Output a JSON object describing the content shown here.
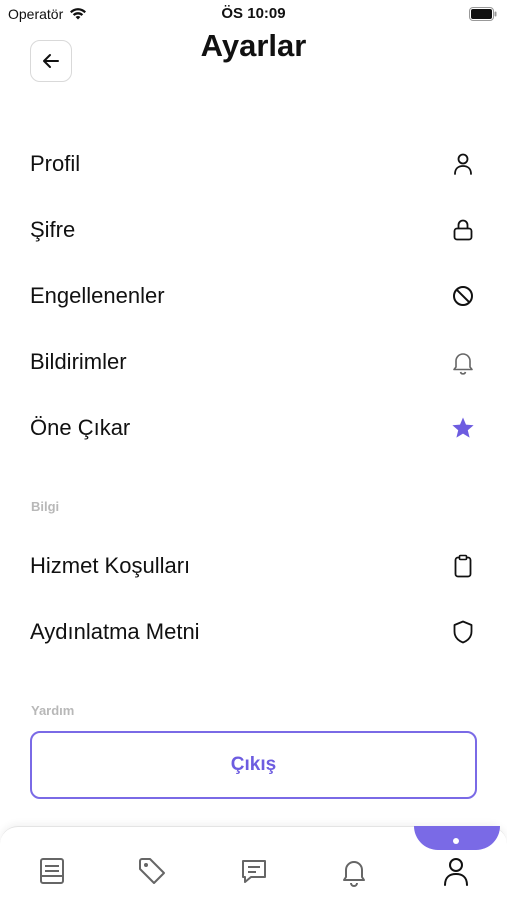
{
  "status_bar": {
    "carrier": "Operatör",
    "time": "ÖS 10:09"
  },
  "header": {
    "title": "Ayarlar"
  },
  "settings": [
    {
      "label": "Profil",
      "icon": "person-icon"
    },
    {
      "label": "Şifre",
      "icon": "lock-icon"
    },
    {
      "label": "Engellenenler",
      "icon": "block-icon"
    },
    {
      "label": "Bildirimler",
      "icon": "bell-icon"
    },
    {
      "label": "Öne Çıkar",
      "icon": "star-icon"
    }
  ],
  "info_section": {
    "label": "Bilgi",
    "items": [
      {
        "label": "Hizmet Koşulları",
        "icon": "clipboard-icon"
      },
      {
        "label": "Aydınlatma Metni",
        "icon": "shield-icon"
      }
    ]
  },
  "help_section": {
    "label": "Yardım"
  },
  "logout": {
    "label": "Çıkış"
  },
  "tab_bar": {
    "active_index": 4,
    "items": [
      {
        "icon": "listing-icon"
      },
      {
        "icon": "tag-icon"
      },
      {
        "icon": "chat-icon"
      },
      {
        "icon": "bell-icon"
      },
      {
        "icon": "profile-icon"
      }
    ]
  },
  "colors": {
    "accent": "#7a6ae6",
    "text": "#111111",
    "muted": "#b8b8b8"
  }
}
